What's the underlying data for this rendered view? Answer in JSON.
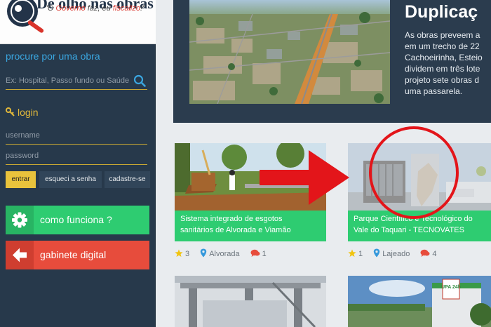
{
  "logo": {
    "title": "De olho nas obras",
    "slogan_q1": "\"O ",
    "slogan_gov": "Governo",
    "slogan_mid": " faz, eu ",
    "slogan_fisc": "fiscalizo",
    "slogan_end": "!\""
  },
  "search": {
    "label": "procure por uma obra",
    "placeholder": "Ex: Hospital, Passo fundo ou Saúde",
    "icon": "search-icon"
  },
  "login": {
    "label": "login",
    "username_placeholder": "username",
    "password_placeholder": "password",
    "enter_label": "entrar",
    "forgot_label": "esqueci a senha",
    "register_label": "cadastre-se"
  },
  "actions": {
    "how_label": "como funciona ?",
    "cabinet_label": "gabinete digital"
  },
  "hero": {
    "title": "Duplicaç",
    "lines": [
      "As obras preveem a",
      "em um trecho de 22",
      "Cachoeirinha, Esteio",
      "dividem em três lote",
      "projeto sete obras d",
      "uma passarela."
    ]
  },
  "cards": [
    {
      "caption_line1": "Sistema integrado de esgotos",
      "caption_line2": "sanitários de Alvorada e Viamão",
      "rating": "3",
      "city": "Alvorada",
      "comments": "1"
    },
    {
      "caption_line1": "Parque Científico e Tecnológico do",
      "caption_line2": "Vale do Taquari - TECNOVATES",
      "rating": "1",
      "city": "Lajeado",
      "comments": "4"
    }
  ],
  "bottom_cards": [
    {
      "sign": ""
    },
    {
      "sign": "UPA 24h"
    }
  ],
  "colors": {
    "sidebar": "#27394b",
    "accent_blue": "#3aa6e0",
    "accent_yellow": "#e9c33c",
    "green": "#2ecc71",
    "red": "#e74c3c",
    "hero_bg": "#2b3c4e"
  }
}
